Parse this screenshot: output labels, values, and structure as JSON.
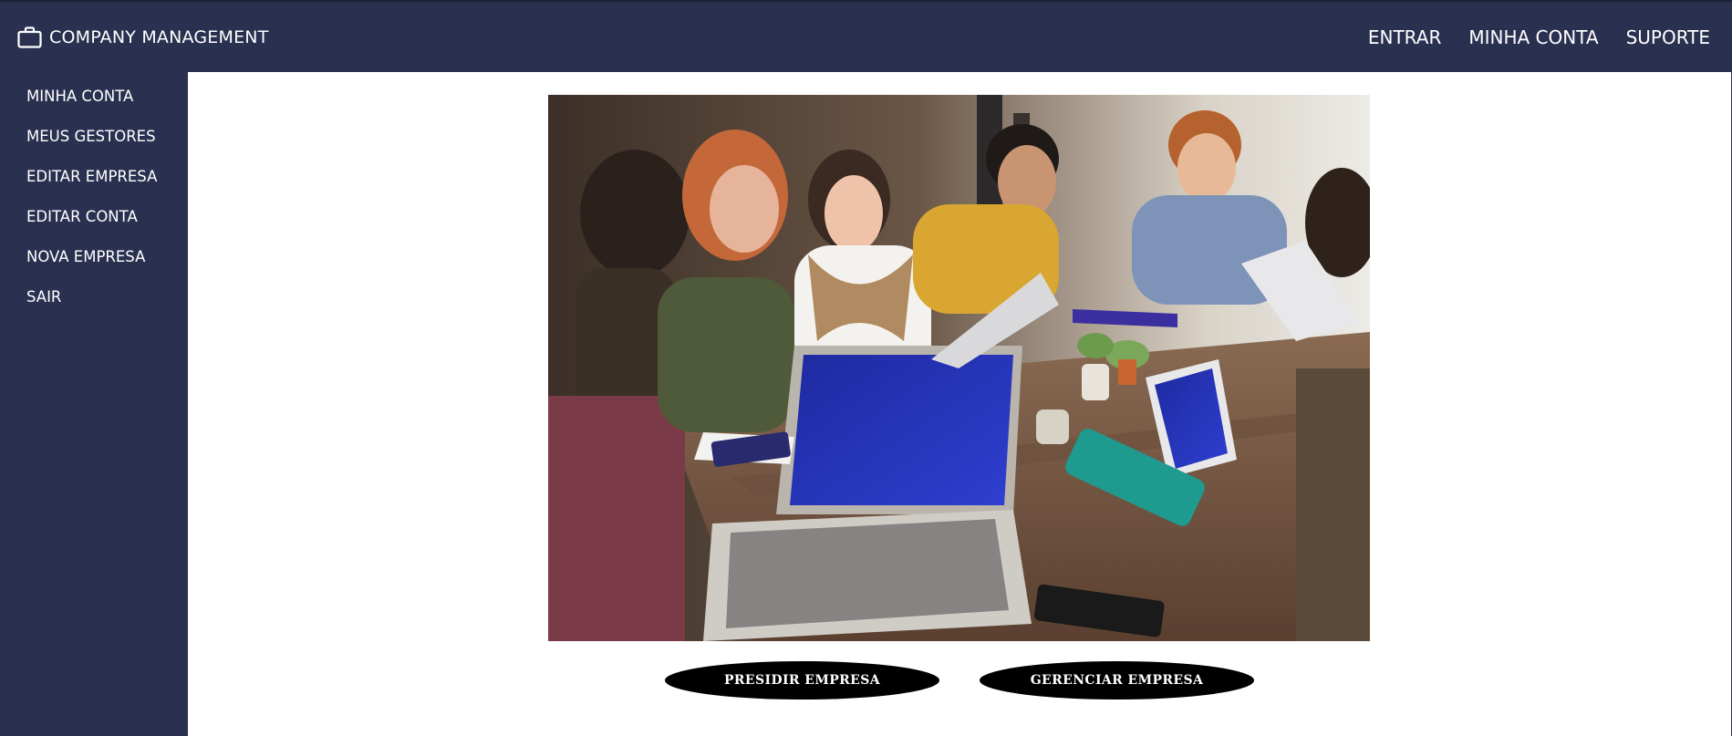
{
  "header": {
    "brand_icon": "briefcase-icon",
    "brand_label": "COMPANY MANAGEMENT",
    "nav": [
      {
        "label": "ENTRAR"
      },
      {
        "label": "MINHA CONTA"
      },
      {
        "label": "SUPORTE"
      }
    ]
  },
  "sidebar": {
    "items": [
      {
        "label": "MINHA CONTA"
      },
      {
        "label": "MEUS GESTORES"
      },
      {
        "label": "EDITAR EMPRESA"
      },
      {
        "label": "EDITAR CONTA"
      },
      {
        "label": "NOVA EMPRESA"
      },
      {
        "label": "SAIR"
      }
    ]
  },
  "main": {
    "buttons": {
      "presidir_label": "PRESIDIR EMPRESA",
      "gerenciar_label": "GERENCIAR EMPRESA"
    }
  },
  "colors": {
    "navy": "#2a3150",
    "button_black": "#000000",
    "content_bg": "#ffffff"
  }
}
